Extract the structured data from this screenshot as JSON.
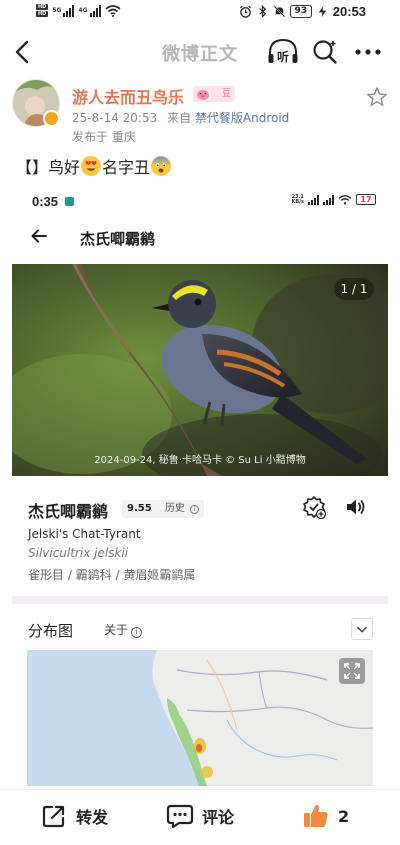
{
  "status_bar": {
    "hd_top": "HD",
    "hd_bottom": "HD",
    "net_5g": "5G",
    "net_4g": "4G",
    "battery": "93",
    "time": "20:53"
  },
  "nav": {
    "title": "微博正文",
    "listen_label": "听"
  },
  "post": {
    "username": "游人去而丑鸟乐",
    "vip_label": "豆",
    "timestamp": "25-8-14 20:53",
    "source_prefix": "来自",
    "source": "禁代餐版Android",
    "location": "发布于 重庆",
    "text_part1": "【】鸟好",
    "text_part2": "名字丑"
  },
  "embed": {
    "status_time": "0:35",
    "net_speed_top": "23.1",
    "net_speed_bottom": "KB/s",
    "battery": "17",
    "page_title": "杰氏唧霸鹟",
    "photo_counter": "1 / 1",
    "photo_caption": "2024-09-24, 秘鲁·卡哈马卡 © Su Li 小黠博物",
    "species_name_cn": "杰氏唧霸鹟",
    "score": "9.55",
    "history_label": "历史",
    "info_glyph": "i",
    "species_name_en": "Jelski's Chat-Tyrant",
    "species_name_latin": "Silvicultrix jelskii",
    "taxonomy": "雀形目 / 霸鹟科 / 黄眉姬霸鹟属",
    "distribution_title": "分布图",
    "about_label": "关于"
  },
  "actions": {
    "repost_label": "转发",
    "comment_label": "评论",
    "like_count": "2"
  },
  "colors": {
    "username": "#eb7350",
    "source_link": "#5b78a7",
    "like_icon": "#f08a3c"
  }
}
